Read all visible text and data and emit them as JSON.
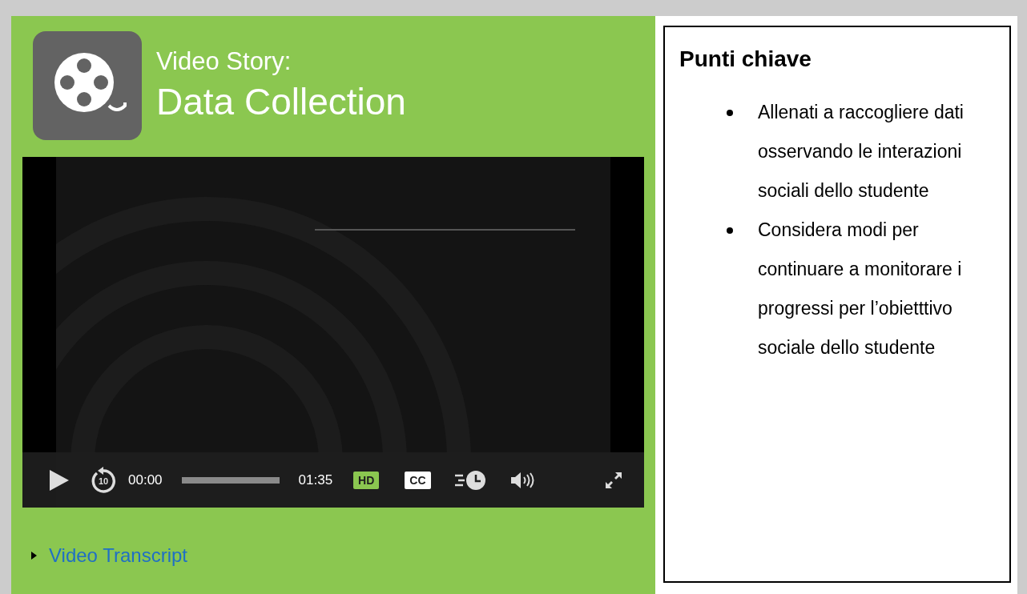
{
  "header": {
    "kicker": "Video Story:",
    "title": "Data Collection"
  },
  "player": {
    "playing": false,
    "rewind_label": "10",
    "current_time": "00:00",
    "level": 0,
    "duration": "01:35",
    "hd": {
      "label": "HD",
      "on": true
    },
    "cc": {
      "label": "CC",
      "on": false
    }
  },
  "transcript": {
    "label": "Video Transcript",
    "expanded": false
  },
  "key_points": {
    "title": "Punti chiave",
    "items": [
      "Allenati a raccogliere dati osservando le interazioni sociali dello studente",
      "Considera modi per continuare a monitorare i progressi per l’obietttivo sociale dello studente"
    ]
  }
}
